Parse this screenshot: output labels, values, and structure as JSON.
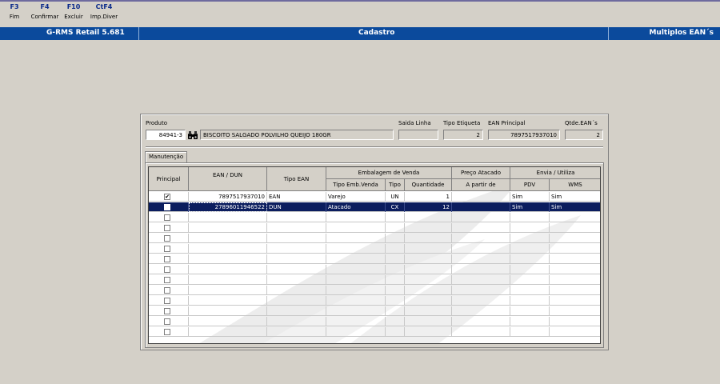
{
  "function_keys": [
    {
      "key": "F3",
      "label": "Fim"
    },
    {
      "key": "F4",
      "label": "Confirmar"
    },
    {
      "key": "F10",
      "label": "Excluir"
    },
    {
      "key": "CtF4",
      "label": "Imp.Diver"
    }
  ],
  "titlebar": {
    "app": "G-RMS Retail 5.681",
    "module": "Cadastro",
    "screen": "Multiplos EAN´s"
  },
  "header": {
    "produto_label": "Produto",
    "produto_code": "84941-3",
    "produto_desc": "BISCOITO SALGADO POLVILHO QUEIJO 180GR",
    "saida_linha_label": "Saida Linha",
    "saida_linha_value": "",
    "tipo_etiqueta_label": "Tipo Etiqueta",
    "tipo_etiqueta_value": "2",
    "ean_principal_label": "EAN Principal",
    "ean_principal_value": "7897517937010",
    "qtde_eans_label": "Qtde.EAN´s",
    "qtde_eans_value": "2"
  },
  "tab_label": "Manutenção",
  "grid": {
    "headers": {
      "principal": "Principal",
      "ean_dun": "EAN / DUN",
      "tipo_ean": "Tipo EAN",
      "embalagem_group": "Embalagem de Venda",
      "tipo_emb_venda": "Tipo Emb.Venda",
      "tipo": "Tipo",
      "quantidade": "Quantidade",
      "preco_group": "Preço Atacado",
      "a_partir_de": "A partir de",
      "envia_group": "Envia / Utiliza",
      "pdv": "PDV",
      "wms": "WMS"
    },
    "rows": [
      {
        "principal": "✔",
        "ean": "7897517937010",
        "tipo_ean": "EAN",
        "tipo_emb": "Varejo",
        "tipo": "UN",
        "quantidade": "1",
        "a_partir": "",
        "pdv": "Sim",
        "wms": "Sim"
      },
      {
        "principal": "",
        "ean": "27896011946522",
        "tipo_ean": "DUN",
        "tipo_emb": "Atacado",
        "tipo": "CX",
        "quantidade": "12",
        "a_partir": "",
        "pdv": "Sim",
        "wms": "Sim"
      }
    ],
    "empty_rows": 12,
    "selected_row": 1
  }
}
